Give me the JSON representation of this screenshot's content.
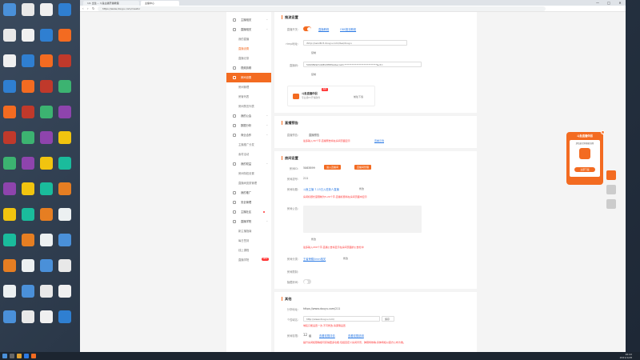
{
  "browser": {
    "tabs": [
      "1/1 出生... 斗鱼主播开播教程",
      "主播中心"
    ],
    "url": "https://www.douyu.com/creator",
    "controls": {
      "minimize": "—",
      "maximize": "□",
      "close": "✕"
    }
  },
  "sidebar": {
    "items": [
      {
        "type": "group",
        "label": "主播相关",
        "arrow": "^"
      },
      {
        "type": "group",
        "label": "直播相关",
        "arrow": "^"
      },
      {
        "type": "sub",
        "label": "我的直播"
      },
      {
        "type": "sub",
        "label": "直播设置",
        "highlight": true
      },
      {
        "type": "sub",
        "label": "直播记录"
      },
      {
        "type": "group",
        "label": "视频剪辑"
      },
      {
        "type": "group",
        "label": "房间设置",
        "active": true
      },
      {
        "type": "sub",
        "label": "房间管理"
      },
      {
        "type": "sub",
        "label": "房管列表"
      },
      {
        "type": "sub",
        "label": "房间禁言列表"
      },
      {
        "type": "group",
        "label": "我的公会",
        "arrow": "^"
      },
      {
        "type": "group",
        "label": "数据分析",
        "arrow": "^"
      },
      {
        "type": "group",
        "label": "商业合作",
        "arrow": "^"
      },
      {
        "type": "sub",
        "label": "主播推广分发"
      },
      {
        "type": "sub",
        "label": "素材活动"
      },
      {
        "type": "group",
        "label": "我的权益",
        "arrow": "^"
      },
      {
        "type": "sub",
        "label": "房间特权设置"
      },
      {
        "type": "sub",
        "label": "直播间皮肤管理"
      },
      {
        "type": "group",
        "label": "我的推广"
      },
      {
        "type": "group",
        "label": "安全管理"
      },
      {
        "type": "group",
        "label": "主播社区",
        "dot": true
      },
      {
        "type": "group",
        "label": "直播学院",
        "arrow": "^"
      },
      {
        "type": "sub",
        "label": "新主播指南"
      },
      {
        "type": "sub",
        "label": "每日签到"
      },
      {
        "type": "sub",
        "label": "线上课程"
      },
      {
        "type": "sub",
        "label": "直播学院",
        "badge": "NEW"
      }
    ]
  },
  "main": {
    "push": {
      "title": "推流设置",
      "toggle_label": "直播开关:",
      "link1": "直播教程",
      "link2": "OBS推流教程",
      "rtmp_label": "rtmp地址:",
      "rtmp_value": "rtmp://sendtc3.douyu.com/live/douyu",
      "copy1": "复制",
      "code_label": "直播码:",
      "code_value": "5063899rhOXEb7EEPkeSecret=***************************&ct=",
      "copy2": "复制",
      "tool_title": "斗鱼直播伴侣",
      "tool_sub": "专业级PC开播软件",
      "tool_download": "前往下载",
      "tool_badge": "推荐"
    },
    "notice": {
      "title": "直播预告",
      "label": "直播预告:",
      "value": "直播预告",
      "warn": "最多输入30个字,直播预告将在房间页面显示",
      "link": "查看示例"
    },
    "room": {
      "title": "房间设置",
      "id_label": "房间ID:",
      "id_value": "5063899",
      "btn1": "进入直播间",
      "btn2": "直播间管理",
      "num_label": "房间靓号:",
      "num_value": "211",
      "name_label": "房间标题:",
      "name_value": "斗鱼主播 7-15日入驻新人直播",
      "name_edit": "修改",
      "name_warn": "房间标题长度限制为5-20个字,直播标题将在房间页面中显示",
      "intro_label": "房间公告:",
      "intro_edit": "修改",
      "intro_warn": "最多输入200个字,直播公告将显示在房间页面的公告栏中",
      "cat_label": "房间分类:",
      "cat_value": "王者荣耀/lmm相关",
      "cat_edit": "修改",
      "limit_label": "房间限制:",
      "hide_label": "隐藏房间:"
    },
    "other": {
      "title": "其他",
      "share_label": "分享地址:",
      "share_value": "https://www.douyu.com/211",
      "domain_label": "个性域名:",
      "domain_value": "http://www.douyu.com/",
      "domain_save": "保存",
      "domain_warn": "域名只能设置一次,不可修改,请谨慎设置",
      "level_label": "房间权限:",
      "level_value": "12",
      "level_unit": "级",
      "level_link1": "查看权限详情",
      "level_link2": "查看权限说明",
      "level_warn": "提升房间权限等级可获得更多功能,包括自定义房间背景、弹幕特效等,具体特权以官方公布为准。"
    }
  },
  "ad": {
    "title": "斗鱼直播伴侣",
    "sub": "超低延迟开播更流畅",
    "btn": "立即下载"
  },
  "taskbar": {
    "time": "16:22",
    "date": "2021/1/28"
  },
  "colors": {
    "accent": "#f36b21",
    "link": "#2d7be5",
    "warn": "#ff3333"
  }
}
